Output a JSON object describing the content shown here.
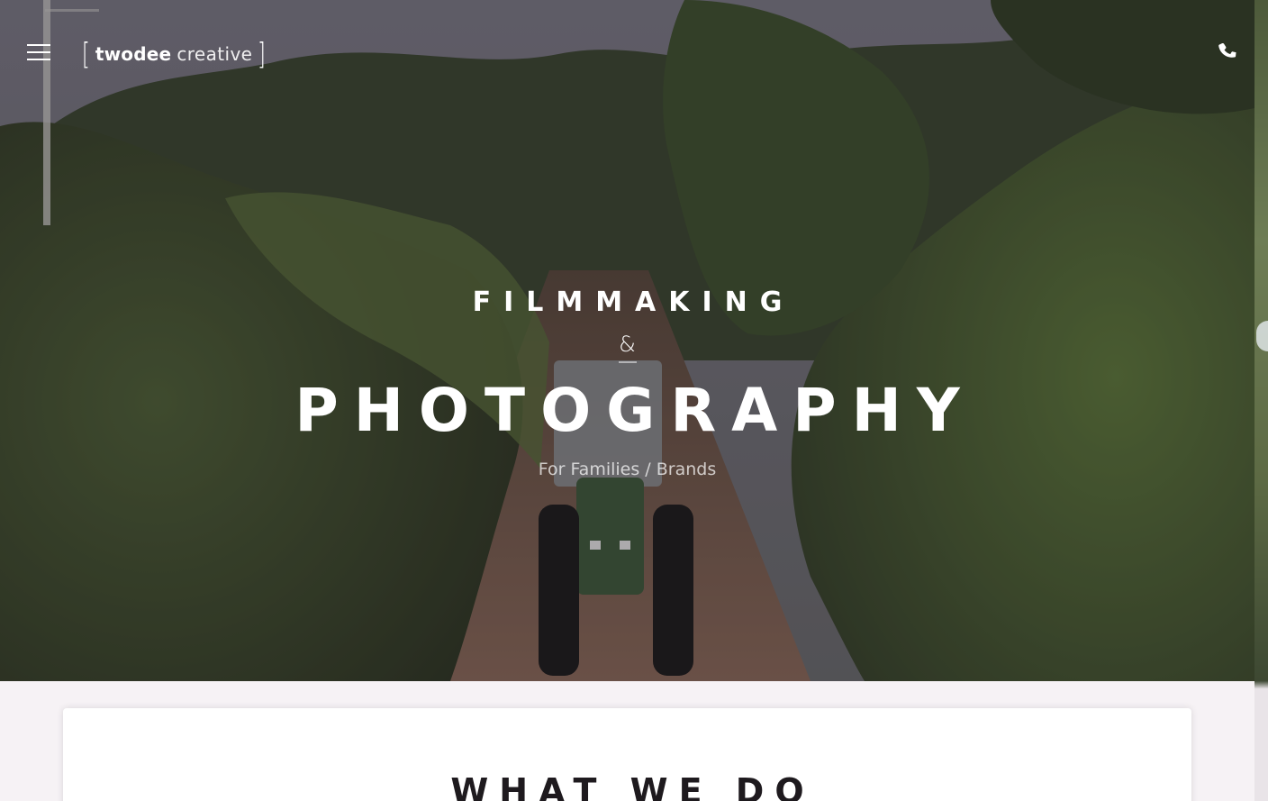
{
  "header": {
    "menu_icon": "hamburger-menu-icon",
    "logo": {
      "word_bold": "twodee",
      "word_light": "creative",
      "bracket_left": "[",
      "bracket_right": "]"
    },
    "phone_icon": "phone-icon"
  },
  "hero": {
    "line1": "FILMMAKING",
    "ampersand": "&",
    "line2": "PHOTOGRAPHY",
    "subtitle": "For Families / Brands"
  },
  "section": {
    "title": "WHAT WE DO"
  },
  "colors": {
    "text_light": "#ffffff",
    "page_bg": "#f6f2f5",
    "card_bg": "#ffffff",
    "heading_dark": "#1e1a1e"
  }
}
